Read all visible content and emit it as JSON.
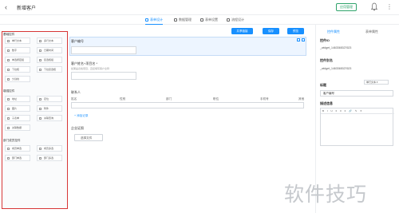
{
  "header": {
    "title": "新增客户",
    "publish_label": "应用管理",
    "more_glyph": "⋮"
  },
  "tabs": [
    {
      "label": "表单设计"
    },
    {
      "label": "数据管理"
    },
    {
      "label": "表单设置"
    },
    {
      "label": "流程设计"
    }
  ],
  "sidebar": {
    "groups": [
      {
        "title": "基础控件",
        "items": [
          "单行文本",
          "多行文本",
          "数字",
          "日期时间",
          "单选按钮组",
          "复选框组",
          "下拉框",
          "下拉复选框",
          "分割线"
        ]
      },
      {
        "title": "增强控件",
        "items": [
          "地址",
          "定位",
          "图片",
          "附件",
          "子表单",
          "关联查询",
          "关联数据"
        ]
      },
      {
        "title": "部门成员控件",
        "items": [
          "成员单选",
          "成员多选",
          "部门单选",
          "部门多选"
        ]
      }
    ]
  },
  "canvas": {
    "toolbar": {
      "btn1": "共享链接",
      "btn2": "保存",
      "btn3": "预览"
    },
    "field1": {
      "label": "客户编号"
    },
    "field2": {
      "label": "客户姓名+项目名 *",
      "hint": "如果是表格项目，直接填写客户全称"
    },
    "subtable": {
      "label": "联系人",
      "columns": [
        "姓名",
        "性别",
        "部门",
        "职位",
        "手机号",
        "其他"
      ]
    },
    "add_record": "+ 添加记录",
    "attachment": {
      "label": "企业证照",
      "button": "选择文件"
    }
  },
  "right_panel": {
    "tabs": [
      "控件属性",
      "表单属性"
    ],
    "control_id_label": "控件ID",
    "control_id_value": "_widget_1463365327623",
    "alias_label": "控件别名",
    "alias_value": "_widget_1463365327623",
    "title_label": "标题",
    "title_type": "单行文本 ▾",
    "title_value": "客户编号",
    "desc_label": "描述信息",
    "editor_tools": "B I U ≡ ≡ ≡ 🔗 ✎ ✕"
  },
  "watermark": "软件技巧",
  "colors": {
    "accent": "#1890ff",
    "publish": "#30a46c",
    "highlight": "#d73636"
  }
}
